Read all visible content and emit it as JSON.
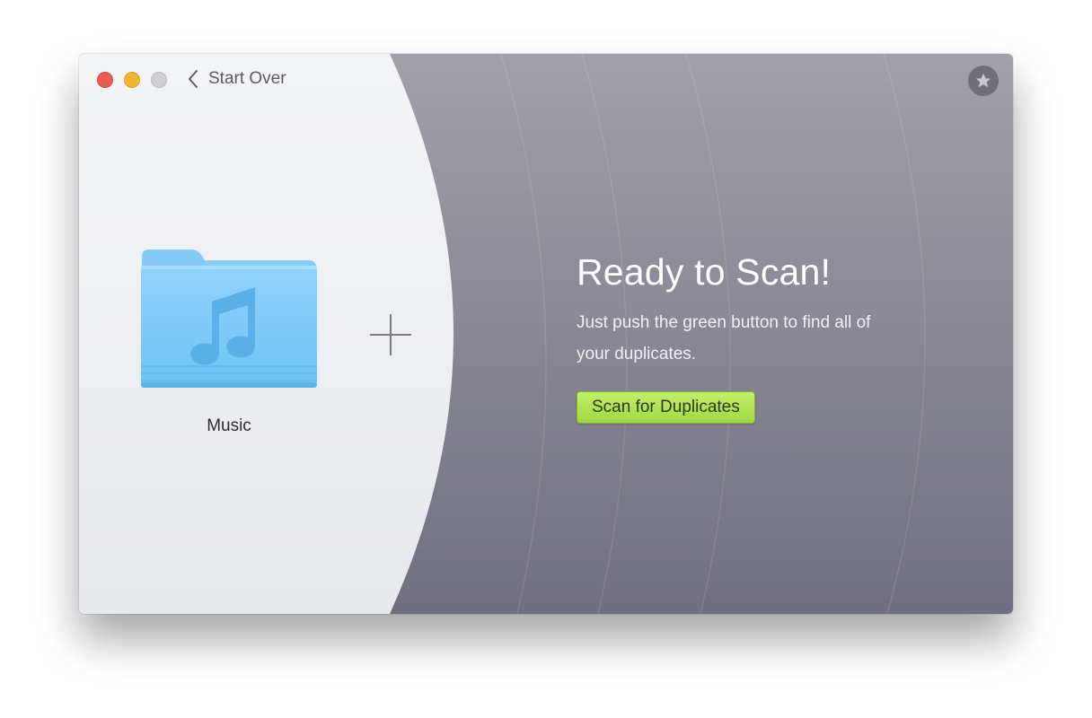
{
  "window": {
    "back_label": "Start Over"
  },
  "left_panel": {
    "folder_label": "Music",
    "folder_icon": "music-folder-icon",
    "add_icon": "plus-icon"
  },
  "right_panel": {
    "title": "Ready to Scan!",
    "description": "Just push the green button to find all of your duplicates.",
    "scan_button": "Scan for Duplicates"
  },
  "colors": {
    "close": "#ee5b52",
    "minimize": "#f4b532",
    "zoom": "#cfcfd4",
    "scan_button": "#a8dd4a",
    "panel_light": "#f0f1f4",
    "panel_dark": "#85848f"
  }
}
